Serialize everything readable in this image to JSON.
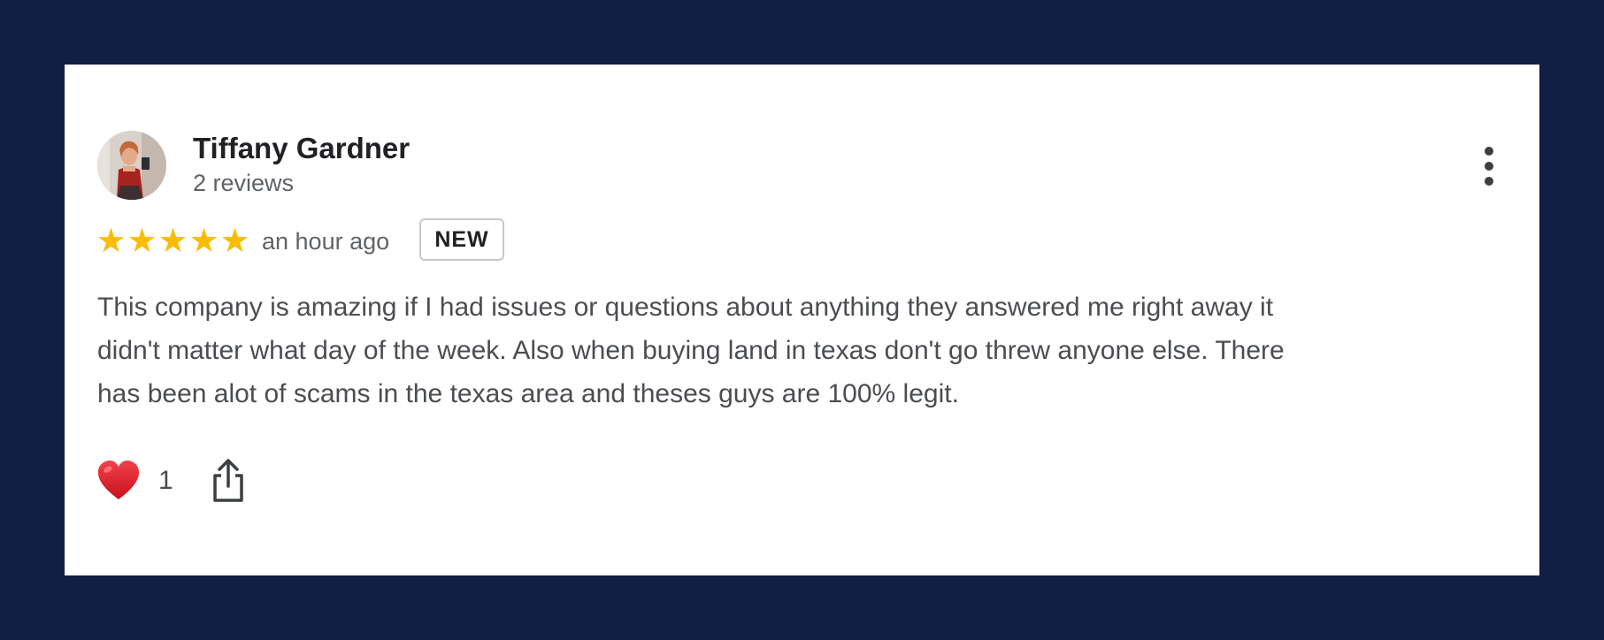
{
  "review": {
    "reviewer_name": "Tiffany Gardner",
    "review_count": "2 reviews",
    "rating": 5,
    "stars": [
      "★",
      "★",
      "★",
      "★",
      "★"
    ],
    "timestamp": "an hour ago",
    "badge": "NEW",
    "text_lines": [
      "This company is amazing if I had issues or questions about anything they answered me right away it",
      "didn't matter what day of the week. Also when buying land in texas don't go threw anyone else. There",
      "has been alot of scams in the texas area and theses guys are 100% legit."
    ],
    "like_count": "1"
  },
  "colors": {
    "page_background": "#121f45",
    "card_background": "#ffffff",
    "star": "#fbbc04",
    "heart": "#e0192a"
  },
  "icons": {
    "more": "more-vertical-icon",
    "like": "heart-icon",
    "share": "share-icon"
  }
}
